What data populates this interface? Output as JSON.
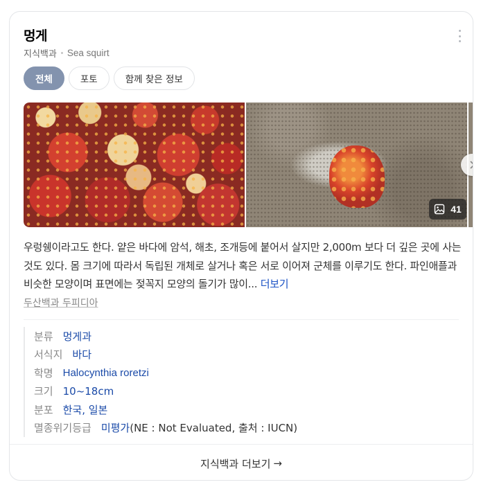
{
  "header": {
    "title": "멍게",
    "source_label": "지식백과",
    "english_name": "Sea squirt"
  },
  "tabs": [
    {
      "label": "전체",
      "active": true
    },
    {
      "label": "포토",
      "active": false
    },
    {
      "label": "함께 찾은 정보",
      "active": false
    }
  ],
  "gallery": {
    "photo_count": "41",
    "icons": {
      "next": "chevron-right-icon",
      "photos": "image-icon"
    }
  },
  "description": {
    "text": "우렁쉥이라고도 한다. 얕은 바다에 암석, 해초, 조개등에 붙어서 살지만 2,000m 보다 더 깊은 곳에 사는 것도 있다. 몸 크기에 따라서 독립된 개체로 살거나 혹은 서로 이어져 군체를 이루기도 한다. 파인애플과 비슷한 모양이며 표면에는 젖꼭지 모양의 돌기가 많이...",
    "more_label": "더보기"
  },
  "source_link": "두산백과 두피디아",
  "info": [
    {
      "key": "분류",
      "value": "멍게과"
    },
    {
      "key": "서식지",
      "value": "바다"
    },
    {
      "key": "학명",
      "value": "Halocynthia roretzi"
    },
    {
      "key": "크기",
      "value": "10~18cm"
    },
    {
      "key": "분포",
      "value": "한국, 일본"
    },
    {
      "key": "멸종위기등급",
      "value": "미평가",
      "extra": "(NE : Not Evaluated, 출처 : IUCN)"
    }
  ],
  "footer": {
    "label": "지식백과 더보기",
    "arrow": "→"
  },
  "colors": {
    "accent_tab": "#8393ae",
    "link": "#1a4aa8",
    "more_link": "#1a51c4"
  }
}
